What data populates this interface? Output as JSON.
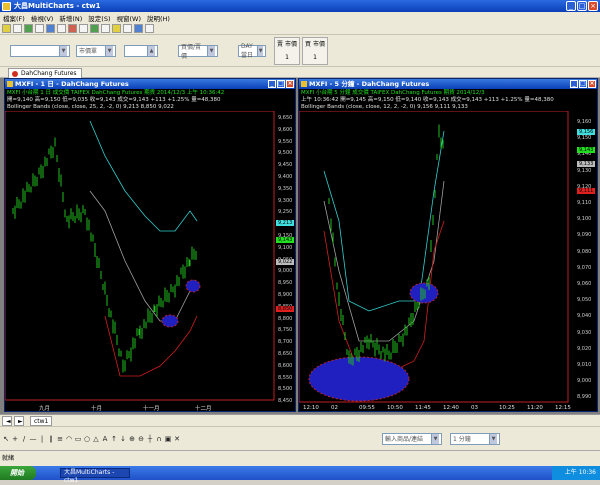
{
  "app": {
    "title": "大昌MultiCharts - ctw1"
  },
  "menu": [
    "檔案(F)",
    "檢視(V)",
    "新增(N)",
    "設定(S)",
    "視窗(W)",
    "說明(H)"
  ],
  "toolbar": {
    "symbol_placeholder": "",
    "market_price_label": "市價單",
    "buy_sell_label": "買價/賣價",
    "day_label": "DAY當日",
    "bid_btn": "賣 市價",
    "bid_qty": "1",
    "ask_btn": "買 市價",
    "ask_qty": "1"
  },
  "workspace_tab": "DahChang Futures",
  "left_chart": {
    "title": "MXFI - 1 日 - DahChang Futures",
    "info1": "MXFI  小台期 1 日  成交價  TAIFEX  DahChang Futures  期貨  2014/12/3  上午 10:36:42",
    "info2": "開=9,140  高=9,150  低=9,035  收=9,143  成交=9,143  +113  +1.25%  量=48,380",
    "indicator": "Bollinger Bands (close, close, 25, 2, -2, 0)  9,213  8,850  9,022",
    "y_labels": [
      "9,650",
      "9,600",
      "9,550",
      "9,500",
      "9,450",
      "9,400",
      "9,350",
      "9,300",
      "9,250",
      "9,200",
      "9,150",
      "9,100",
      "9,050",
      "9,000",
      "8,950",
      "8,900",
      "8,850",
      "8,800",
      "8,750",
      "8,700",
      "8,650",
      "8,600",
      "8,550",
      "8,500",
      "8,450"
    ],
    "x_labels": [
      "九月",
      "十月",
      "十一月",
      "十二月"
    ],
    "price_tags": [
      {
        "text": "9,213",
        "color": "#40e0e0"
      },
      {
        "text": "9,143",
        "color": "#20e020"
      },
      {
        "text": "9,022",
        "color": "#bbbbbb"
      },
      {
        "text": "8,850",
        "color": "#e02020"
      }
    ]
  },
  "right_chart": {
    "title": "MXFI - 5 分鐘 - DahChang Futures",
    "info1": "MXFI  小台期 5 分鐘  成交價  TAIFEX  DahChang Futures  期貨  2014/12/3",
    "info2": "上午 10:36:42  開=9,145  高=9,150  低=9,140  收=9,143  成交=9,143  +113  +1.25%  量=48,380",
    "indicator": "Bollinger Bands (close, close, 12, 2, -2, 0)  9,156  9,111  9,133",
    "y_labels": [
      "9,160",
      "9,150",
      "9,140",
      "9,130",
      "9,120",
      "9,110",
      "9,100",
      "9,090",
      "9,080",
      "9,070",
      "9,060",
      "9,050",
      "9,040",
      "9,030",
      "9,020",
      "9,010",
      "9,000",
      "8,990"
    ],
    "x_labels": [
      "12:10",
      "02",
      "09:55",
      "10:50",
      "11:45",
      "12:40",
      "03",
      "10:25",
      "11:20",
      "12:15"
    ],
    "price_tags": [
      {
        "text": "9,156",
        "color": "#40e0e0"
      },
      {
        "text": "9,143",
        "color": "#20e020"
      },
      {
        "text": "9,133",
        "color": "#bbbbbb"
      },
      {
        "text": "9,111",
        "color": "#e02020"
      }
    ]
  },
  "bottom_tab": "ctw1",
  "draw_toolbar": {
    "symbol_combo": "輸入商品/連結",
    "interval_combo": "1 分鐘"
  },
  "statusbar": {
    "ready": "就緒"
  },
  "taskbar": {
    "start": "開始",
    "task": "大昌MultiCharts - ctw1",
    "time": "上午 10:36"
  },
  "colors": {
    "upper_band": "#30d0d0",
    "lower_band": "#d02020",
    "mid_band": "#a0a0a0",
    "candles": "#20c020",
    "highlight": "#2020c0"
  }
}
